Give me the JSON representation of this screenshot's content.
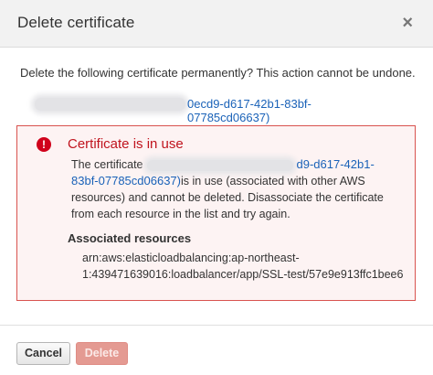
{
  "dialog": {
    "title": "Delete certificate",
    "close_label": "×",
    "message": "Delete the following certificate permanently? This action cannot be undone.",
    "certificate_link_suffix": "0ecd9-d617-42b1-83bf-07785cd06637)"
  },
  "alert": {
    "icon_glyph": "!",
    "title": "Certificate is in use",
    "text_prefix": "The certificate",
    "cert_link_line1": "d9-d617-42b1-",
    "cert_link_line2": "83bf-07785cd06637)",
    "text_after_link": "is in use (associated with other AWS resources) and cannot be deleted. Disassociate the certificate from each resource in the list and try again.",
    "associated_title": "Associated resources",
    "resources": [
      "arn:aws:elasticloadbalancing:ap-northeast-1:439471639016:loadbalancer/app/SSL-test/57e9e913ffc1bee6"
    ]
  },
  "footer": {
    "cancel_label": "Cancel",
    "delete_label": "Delete"
  },
  "colors": {
    "error": "#c0141e",
    "link": "#1a62b8",
    "delete_button": "#e49a92"
  }
}
